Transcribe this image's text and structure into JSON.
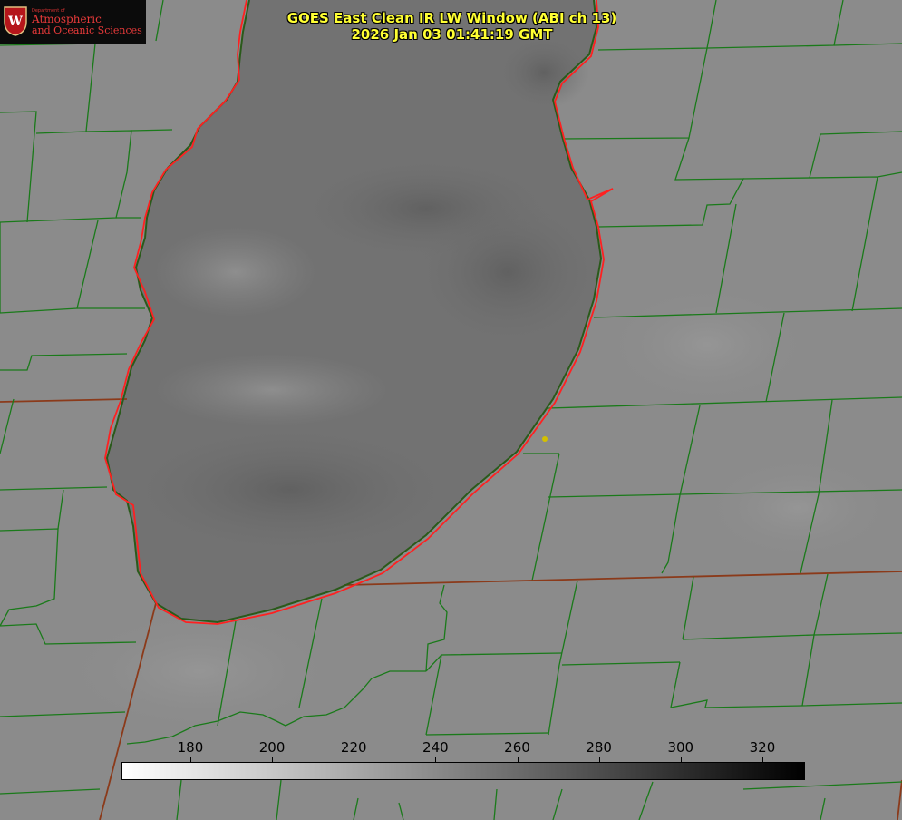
{
  "title": {
    "line1": "GOES East Clean IR LW Window (ABI ch 13)",
    "line2": "2026 Jan 03 01:41:19 GMT"
  },
  "logo": {
    "dept": "Department of",
    "line1": "Atmospheric",
    "line2": "and Oceanic Sciences",
    "seal_letter": "W"
  },
  "colorbar": {
    "ticks": [
      "180",
      "200",
      "220",
      "240",
      "260",
      "280",
      "300",
      "320"
    ],
    "min": 163.15,
    "max": 330.0,
    "colors": {
      "low": "#ffffff",
      "high": "#000000"
    }
  },
  "colors": {
    "land": "#8a8a8a",
    "lake": "#6f6f6f",
    "county_lines": "#1a7a1a",
    "coastline": "#ff2020",
    "title_text": "#ffff33",
    "marker": "#d4c000"
  }
}
